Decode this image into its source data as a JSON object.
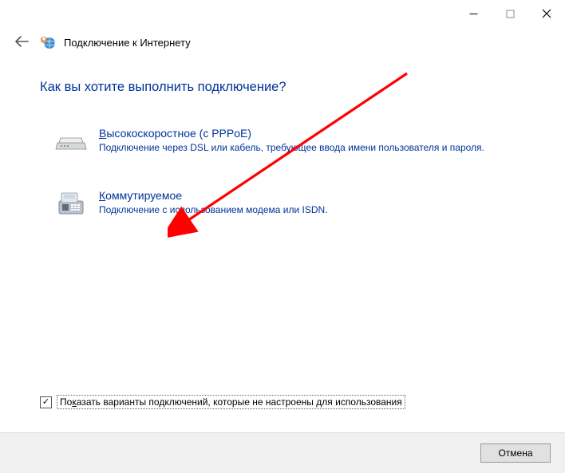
{
  "window": {
    "title": "Подключение к Интернету"
  },
  "heading": "Как вы хотите выполнить подключение?",
  "options": {
    "broadband": {
      "mnemonic": "В",
      "title_rest": "ысокоскоростное (с PPPoE)",
      "desc": "Подключение через DSL или кабель, требующее ввода имени пользователя и пароля."
    },
    "dialup": {
      "mnemonic": "К",
      "title_rest": "оммутируемое",
      "desc": "Подключение с использованием модема или ISDN."
    }
  },
  "checkbox": {
    "checked_glyph": "✓",
    "label_pre": "По",
    "label_mnemonic": "к",
    "label_post": "азать варианты подключений, которые не настроены для использования"
  },
  "footer": {
    "cancel": "Отмена"
  }
}
